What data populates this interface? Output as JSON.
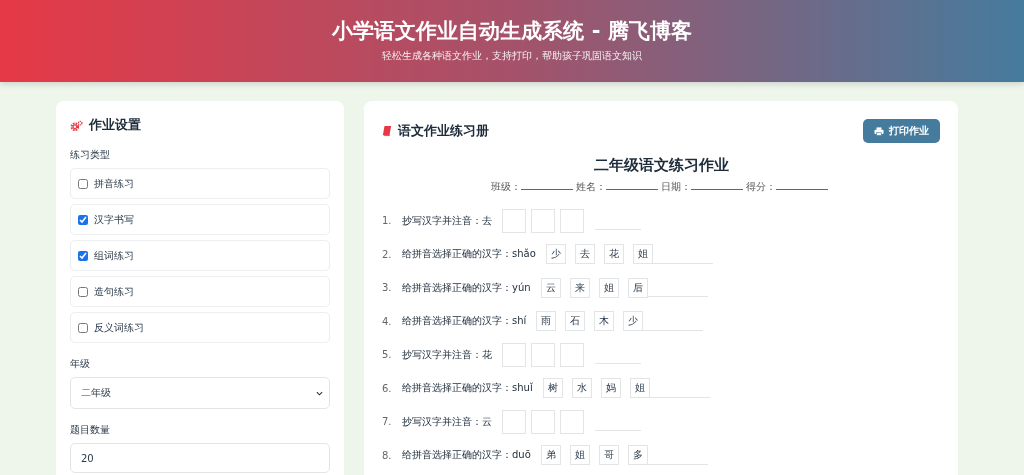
{
  "header": {
    "title": "小学语文作业自动生成系统 - 腾飞博客",
    "subtitle": "轻松生成各种语文作业，支持打印，帮助孩子巩固语文知识"
  },
  "settings": {
    "title": "作业设置",
    "types_label": "练习类型",
    "types": [
      {
        "label": "拼音练习",
        "checked": false
      },
      {
        "label": "汉字书写",
        "checked": true
      },
      {
        "label": "组词练习",
        "checked": true
      },
      {
        "label": "造句练习",
        "checked": false
      },
      {
        "label": "反义词练习",
        "checked": false
      }
    ],
    "grade_label": "年级",
    "grade_value": "二年级",
    "count_label": "题目数量",
    "count_value": "20"
  },
  "workbook": {
    "title": "语文作业练习册",
    "print_button": "打印作业",
    "sheet_title": "二年级语文练习作业",
    "fields": [
      "班级：",
      "姓名：",
      "日期：",
      "得分："
    ],
    "questions": [
      {
        "kind": "copy",
        "number": "1.",
        "text": "抄写汉字并注音：去"
      },
      {
        "kind": "choose",
        "number": "2.",
        "text": "给拼音选择正确的汉字：shǎo",
        "options": [
          "少",
          "去",
          "花",
          "姐"
        ]
      },
      {
        "kind": "choose",
        "number": "3.",
        "text": "给拼音选择正确的汉字：yún",
        "options": [
          "云",
          "来",
          "姐",
          "后"
        ]
      },
      {
        "kind": "choose",
        "number": "4.",
        "text": "给拼音选择正确的汉字：shí",
        "options": [
          "雨",
          "石",
          "木",
          "少"
        ]
      },
      {
        "kind": "copy",
        "number": "5.",
        "text": "抄写汉字并注音：花"
      },
      {
        "kind": "choose",
        "number": "6.",
        "text": "给拼音选择正确的汉字：shuǐ",
        "options": [
          "树",
          "水",
          "妈",
          "姐"
        ]
      },
      {
        "kind": "copy",
        "number": "7.",
        "text": "抄写汉字并注音：云"
      },
      {
        "kind": "choose",
        "number": "8.",
        "text": "给拼音选择正确的汉字：duō",
        "options": [
          "弟",
          "姐",
          "哥",
          "多"
        ]
      }
    ]
  }
}
